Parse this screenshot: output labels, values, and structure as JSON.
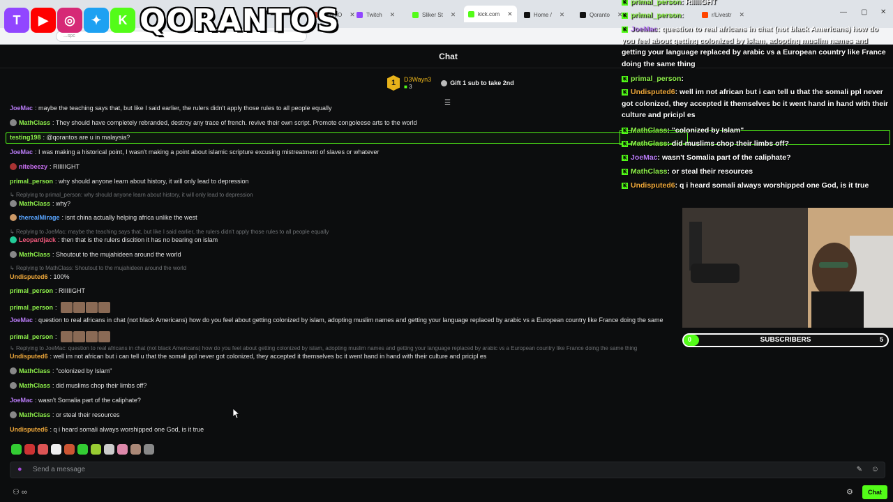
{
  "browser": {
    "tabs": [
      {
        "label": "ISLAMO",
        "color": "#c43"
      },
      {
        "label": "Twitch",
        "color": "#9146ff"
      },
      {
        "label": "Sliker St",
        "color": "#53fc18"
      },
      {
        "label": "kick.com",
        "color": "#53fc18"
      },
      {
        "label": "Home /",
        "color": "#111"
      },
      {
        "label": "Qoranto",
        "color": "#111"
      },
      {
        "label": "r/Livestr",
        "color": "#ff4500"
      }
    ],
    "url": "...spc"
  },
  "banner": {
    "brand": "QORANTOS",
    "socials": [
      {
        "name": "twitch-icon",
        "color": "#9146ff",
        "glyph": "T"
      },
      {
        "name": "youtube-icon",
        "color": "#ff0000",
        "glyph": "▶"
      },
      {
        "name": "instagram-icon",
        "color": "#d62976",
        "glyph": "◎"
      },
      {
        "name": "twitter-icon",
        "color": "#1da1f2",
        "glyph": "✦"
      },
      {
        "name": "kick-icon",
        "color": "#53fc18",
        "glyph": "K"
      }
    ]
  },
  "chat": {
    "title": "Chat",
    "pinned": {
      "rank": "1",
      "name": "D3Wayn3",
      "count": "3",
      "gift": "Gift 1 sub to take 2nd"
    },
    "input_placeholder": "Send a message",
    "send_label": "Chat",
    "messages": [
      {
        "kind": "msg",
        "user": "JoeMac",
        "color": "#b97cf7",
        "text": ": maybe the teaching says that, but like I said earlier, the rulers didn't apply those rules to all people equally"
      },
      {
        "kind": "msg",
        "user": "MathClass",
        "color": "#8ef04b",
        "badge": "#888",
        "text": ": They should have completely rebranded, destroy any trace of french. revive their own script. Promote congoleese arts to the world"
      },
      {
        "kind": "msg",
        "user": "testing198",
        "color": "#8ef04b",
        "text": ": @qorantos are u in malaysia?"
      },
      {
        "kind": "msg",
        "user": "JoeMac",
        "color": "#b97cf7",
        "text": ": I was making a historical point, I wasn't making a point about islamic scripture excusing mistreatment of slaves or whatever"
      },
      {
        "kind": "msg",
        "user": "nitebeezy",
        "color": "#c970f2",
        "badge": "#a33",
        "text": ": RIIIIIGHT"
      },
      {
        "kind": "msg",
        "user": "primal_person",
        "color": "#8ef04b",
        "text": ": why should anyone learn about history, it will only lead to depression"
      },
      {
        "kind": "reply",
        "text": "Replying to primal_person: why should anyone learn about history, it will only lead to depression"
      },
      {
        "kind": "msg",
        "user": "MathClass",
        "color": "#8ef04b",
        "badge": "#888",
        "text": ": why?"
      },
      {
        "kind": "msg",
        "user": "therealMirage",
        "color": "#59a5ff",
        "badge": "#c96",
        "text": ": isnt china actually helping africa unlike the west"
      },
      {
        "kind": "reply",
        "text": "Replying to JoeMac: maybe the teaching says that, but like I said earlier, the rulers didn't apply those rules to all people equally"
      },
      {
        "kind": "msg",
        "user": "Leopardjack",
        "color": "#f05a7c",
        "badge": "#2c9",
        "text": ": then that is the rulers discition it has no bearing on islam"
      },
      {
        "kind": "msg",
        "user": "MathClass",
        "color": "#8ef04b",
        "badge": "#888",
        "text": ": Shoutout to the mujahideen around the world"
      },
      {
        "kind": "reply",
        "text": "Replying to MathClass: Shoutout to the mujahideen around the world"
      },
      {
        "kind": "msg",
        "user": "Undisputed6",
        "color": "#f0a93b",
        "text": ": 100%"
      },
      {
        "kind": "msg",
        "user": "primal_person",
        "color": "#8ef04b",
        "text": ": RIIIIIGHT"
      },
      {
        "kind": "msg",
        "user": "primal_person",
        "color": "#8ef04b",
        "text": ":"
      },
      {
        "kind": "msg",
        "user": "JoeMac",
        "color": "#b97cf7",
        "text": ": question to real africans in chat (not black Americans) how do you feel about getting colonized by islam, adopting muslim names and getting your language replaced by arabic vs a European country like France doing the same"
      },
      {
        "kind": "msg",
        "user": "primal_person",
        "color": "#8ef04b",
        "text": ":"
      },
      {
        "kind": "reply",
        "text": "Replying to JoeMac: question to real africans in chat (not black Americans) how do you feel about getting colonized by islam, adopting muslim names and getting your language replaced by arabic vs a European country like France doing the same thing"
      },
      {
        "kind": "msg",
        "user": "Undisputed6",
        "color": "#f0a93b",
        "text": ": well im not african but i can tell u that the somali ppl never got colonized, they accepted it themselves bc it went hand in hand with their culture and pricipl es"
      },
      {
        "kind": "msg",
        "user": "MathClass",
        "color": "#8ef04b",
        "badge": "#888",
        "text": ": \"colonized by Islam\""
      },
      {
        "kind": "msg",
        "user": "MathClass",
        "color": "#8ef04b",
        "badge": "#888",
        "text": ": did muslims chop their limbs off?"
      },
      {
        "kind": "msg",
        "user": "JoeMac",
        "color": "#b97cf7",
        "text": ": wasn't Somalia part of the caliphate?"
      },
      {
        "kind": "msg",
        "user": "MathClass",
        "color": "#8ef04b",
        "badge": "#888",
        "text": ": or steal their resources"
      },
      {
        "kind": "msg",
        "user": "Undisputed6",
        "color": "#f0a93b",
        "text": ": q i heard somali always worshipped one God, is it true"
      }
    ],
    "emotes": [
      "#3c3",
      "#c33",
      "#d55",
      "#eee",
      "#c53",
      "#3c3",
      "#9c3",
      "#ccc",
      "#d8a",
      "#a87",
      "#888"
    ]
  },
  "overlay": {
    "lines": [
      {
        "user": "primal_person",
        "color": "#8ef04b",
        "text": ": RIIIIIGHT"
      },
      {
        "user": "primal_person",
        "color": "#8ef04b",
        "text": ":"
      },
      {
        "user": "JoeMac",
        "color": "#b97cf7",
        "text": ": question to real africans in chat (not black Americans) how do you feel about getting colonized by islam, adopting muslim names and getting your language replaced by arabic vs a European country like France doing the same thing"
      },
      {
        "user": "primal_person",
        "color": "#8ef04b",
        "text": ":"
      },
      {
        "user": "Undisputed6",
        "color": "#f0a93b",
        "text": ": well im not african but i can tell u that the somali ppl never got colonized, they accepted it themselves bc it went hand in hand with their culture and pricipl es"
      },
      {
        "user": "MathClass",
        "color": "#8ef04b",
        "text": ": \"colonized by Islam\""
      },
      {
        "user": "MathClass",
        "color": "#8ef04b",
        "text": ": did muslims chop their limbs off?"
      },
      {
        "user": "JoeMac",
        "color": "#b97cf7",
        "text": ": wasn't Somalia part of the caliphate?"
      },
      {
        "user": "MathClass",
        "color": "#8ef04b",
        "text": ": or steal their resources"
      },
      {
        "user": "Undisputed6",
        "color": "#f0a93b",
        "text": ": q i heard somali always worshipped one God, is it true"
      }
    ]
  },
  "subgoal": {
    "label": "SUBSCRIBERS",
    "current": "0",
    "goal": "5",
    "progress": 0.0
  }
}
